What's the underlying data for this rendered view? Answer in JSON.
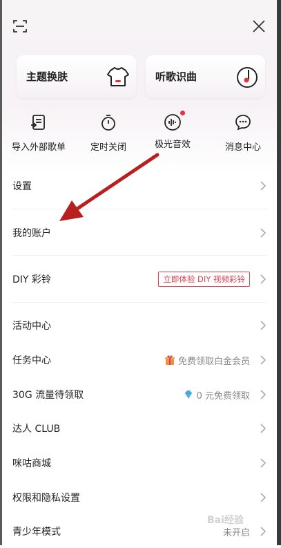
{
  "cards": [
    {
      "label": "主题换肤"
    },
    {
      "label": "听歌识曲"
    }
  ],
  "quick_actions": [
    {
      "label": "导入外部歌单"
    },
    {
      "label": "定时关闭"
    },
    {
      "label": "极光音效"
    },
    {
      "label": "消息中心"
    }
  ],
  "menu": [
    {
      "label": "设置",
      "right": ""
    },
    {
      "label": "我的账户",
      "right": ""
    },
    {
      "label": "DIY 彩铃",
      "right": "立即体验 DIY 视频彩铃"
    },
    {
      "label": "活动中心",
      "right": ""
    },
    {
      "label": "任务中心",
      "right": "免费领取白金会员"
    },
    {
      "label": "30G 流量待领取",
      "right": "0 元免费领取"
    },
    {
      "label": "达人 CLUB",
      "right": ""
    },
    {
      "label": "咪咕商城",
      "right": ""
    },
    {
      "label": "权限和隐私设置",
      "right": ""
    },
    {
      "label": "青少年模式",
      "right": "未开启"
    }
  ],
  "watermark": "Bai经验",
  "colors": {
    "accent": "#e0353e",
    "arrow": "#b81f1f"
  }
}
